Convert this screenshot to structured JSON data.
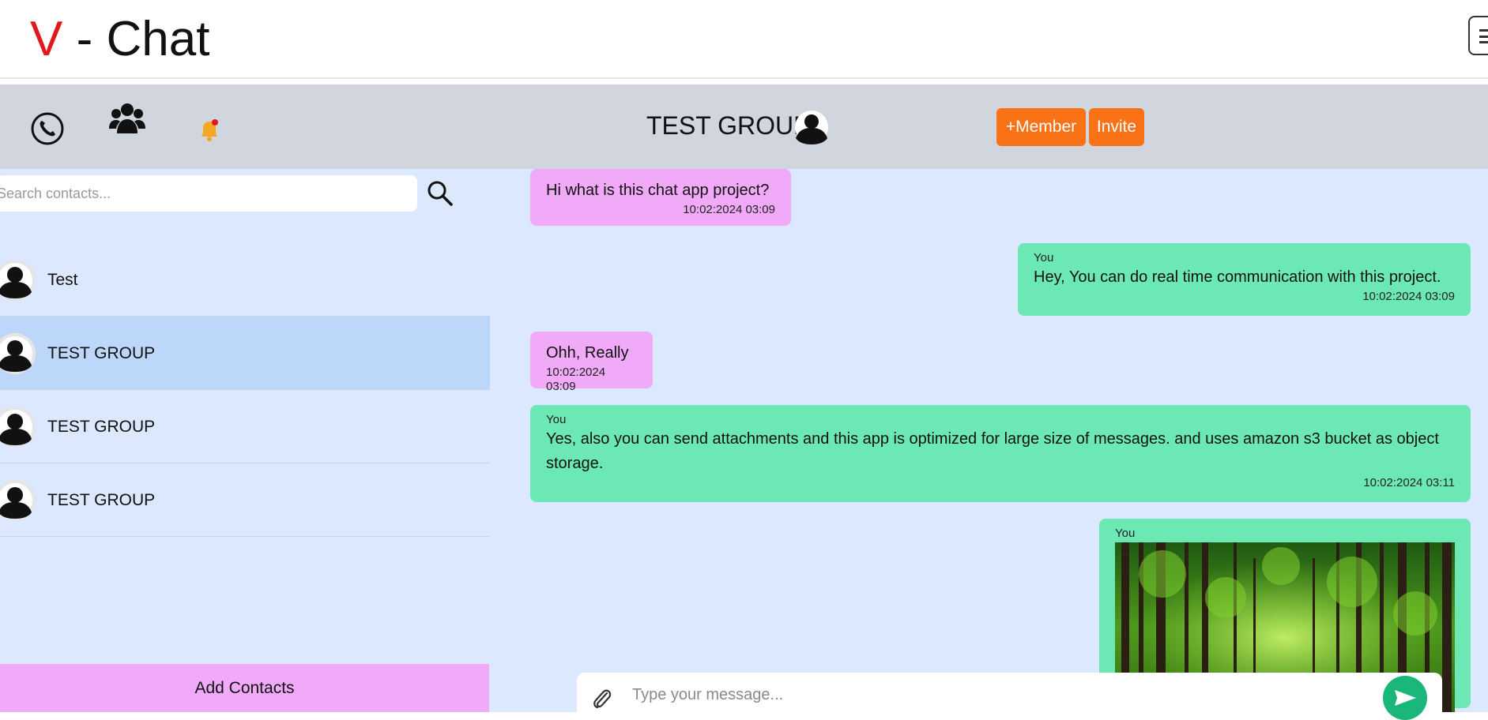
{
  "brand": {
    "letter": "V",
    "rest": " - Chat"
  },
  "header": {
    "group_title": "TEST GROUP",
    "member_button": "+Member",
    "invite_button": "Invite"
  },
  "sidebar": {
    "search_placeholder": "Search contacts...",
    "contacts": [
      {
        "name": "Test"
      },
      {
        "name": "TEST GROUP"
      },
      {
        "name": "TEST GROUP"
      },
      {
        "name": "TEST GROUP"
      }
    ],
    "add_contacts_label": "Add Contacts"
  },
  "messages": [
    {
      "sender": "",
      "text": "Hi what is this chat app project?",
      "time": "10:02:2024 03:09"
    },
    {
      "sender": "You",
      "text": "Hey, You can do real time communication with this project.",
      "time": "10:02:2024 03:09"
    },
    {
      "sender": "",
      "text": "Ohh, Really",
      "time": "10:02:2024 03:09"
    },
    {
      "sender": "You",
      "text": "Yes, also you can send attachments and this app is optimized for large size of messages. and uses amazon s3 bucket as object storage.",
      "time": "10:02:2024 03:11"
    },
    {
      "sender": "You",
      "text": "",
      "time": ""
    }
  ],
  "composer": {
    "placeholder": "Type your message..."
  },
  "colors": {
    "brand_accent": "#e0191c",
    "header_bg": "#d1d5de",
    "sidebar_bg": "#dbe8fe",
    "active_contact": "#bdd7fb",
    "incoming_bubble": "#f0aaf7",
    "outgoing_bubble": "#6ce8b5",
    "action_button": "#f97316",
    "send_button": "#1bb67a"
  },
  "icons": {
    "call": "phone-icon",
    "group": "group-icon",
    "notifications": "bell-icon",
    "search": "search-icon",
    "attach": "paperclip-icon",
    "send": "send-icon",
    "menu": "hamburger-icon"
  }
}
